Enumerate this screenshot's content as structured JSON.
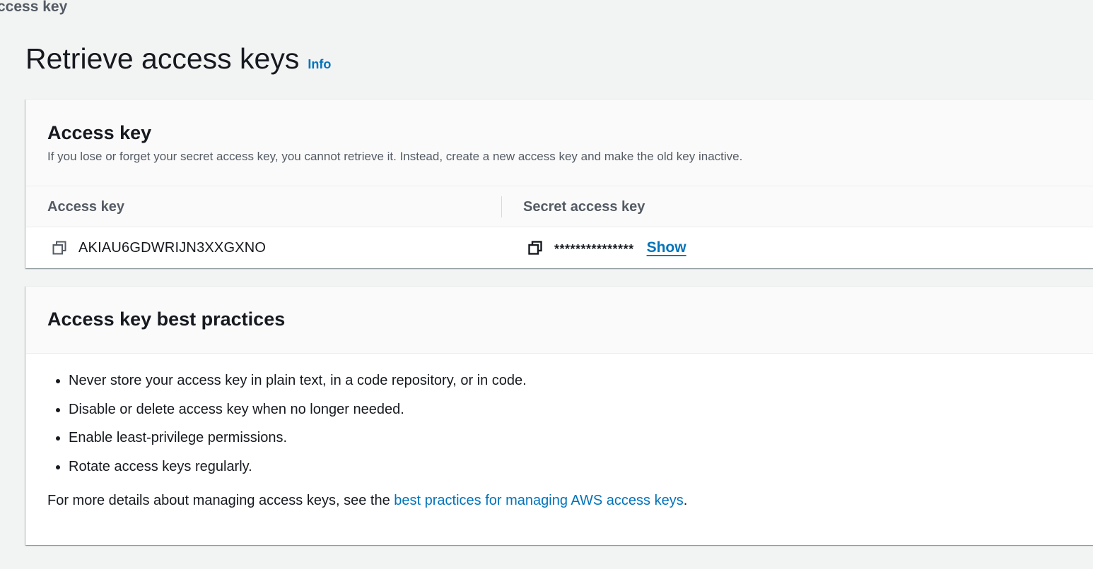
{
  "breadcrumb": {
    "current": "ccess key"
  },
  "header": {
    "title": "Retrieve access keys",
    "info_label": "Info"
  },
  "access_key_panel": {
    "heading": "Access key",
    "description": "If you lose or forget your secret access key, you cannot retrieve it. Instead, create a new access key and make the old key inactive.",
    "columns": [
      "Access key",
      "Secret access key"
    ],
    "access_key_value": "AKIAU6GDWRIJN3XXGXNO",
    "secret_masked": "***************",
    "show_label": "Show"
  },
  "best_practices_panel": {
    "heading": "Access key best practices",
    "items": [
      "Never store your access key in plain text, in a code repository, or in code.",
      "Disable or delete access key when no longer needed.",
      "Enable least-privilege permissions.",
      "Rotate access keys regularly."
    ],
    "more_details_prefix": "For more details about managing access keys, see the ",
    "more_details_link": "best practices for managing AWS access keys",
    "more_details_suffix": "."
  },
  "colors": {
    "link": "#0073bb",
    "text": "#16191f",
    "muted_text": "#545b64",
    "background": "#f2f3f3"
  },
  "icons": {
    "copy_access_key": "copy-icon",
    "copy_secret_key": "copy-icon"
  }
}
